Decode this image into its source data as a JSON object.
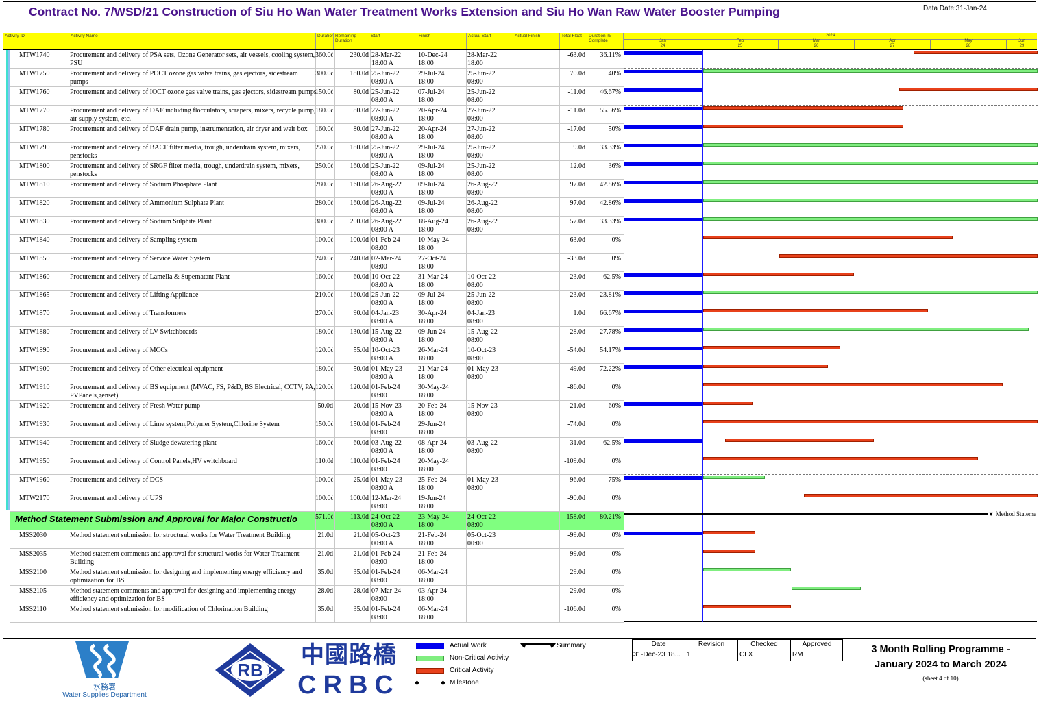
{
  "header": {
    "title": "Contract No. 7/WSD/21 Construction of Siu Ho Wan Water Treatment Works Extension and Siu Ho Wan Raw Water Booster Pumping",
    "data_date": "Data Date:31-Jan-24"
  },
  "columns": [
    "Activity ID",
    "Activity Name",
    "Duration",
    "Remaining Duration",
    "Start",
    "Finish",
    "Actual Start",
    "Actual Finish",
    "Total Float",
    "Duration % Complete"
  ],
  "timescale": {
    "year": "2024",
    "months": [
      {
        "label": "Jan",
        "week": "24"
      },
      {
        "label": "Feb",
        "week": "25"
      },
      {
        "label": "Mar",
        "week": "26"
      },
      {
        "label": "Apr",
        "week": "27"
      },
      {
        "label": "May",
        "week": "28"
      },
      {
        "label": "Jun",
        "week": "29"
      }
    ]
  },
  "rows": [
    {
      "id": "MTW1740",
      "name": "Procurement and delivery of PSA sets, Ozone Generator sets, air vessels, cooling system, PSU",
      "dur": "360.0d",
      "rem": "230.0d",
      "start": "28-Mar-22",
      "start2": "18:00 A",
      "finish": "10-Dec-24",
      "finish2": "18:00",
      "astart": "28-Mar-22",
      "astart2": "18:00",
      "tf": "-63.0d",
      "pc": "36.11%",
      "actual": true,
      "bar": {
        "type": "crit",
        "from": 0.7,
        "to": 1.0
      },
      "dash": true
    },
    {
      "id": "MTW1750",
      "name": "Procurement and delivery of POCT ozone gas valve trains, gas ejectors, sidestream pumps",
      "dur": "300.0d",
      "rem": "180.0d",
      "start": "25-Jun-22",
      "start2": "08:00 A",
      "finish": "29-Jul-24",
      "finish2": "18:00",
      "astart": "25-Jun-22",
      "astart2": "08:00",
      "tf": "70.0d",
      "pc": "40%",
      "actual": true,
      "bar": {
        "type": "ncrit",
        "from": 0.19,
        "to": 1.0
      },
      "dash": false
    },
    {
      "id": "MTW1760",
      "name": "Procurement and delivery of IOCT ozone gas valve trains, gas ejectors, sidestream pumps",
      "dur": "150.0d",
      "rem": "80.0d",
      "start": "25-Jun-22",
      "start2": "08:00 A",
      "finish": "07-Jul-24",
      "finish2": "18:00",
      "astart": "25-Jun-22",
      "astart2": "08:00",
      "tf": "-11.0d",
      "pc": "46.67%",
      "actual": true,
      "bar": {
        "type": "crit",
        "from": 0.665,
        "to": 1.0
      },
      "dash": true
    },
    {
      "id": "MTW1770",
      "name": "Procurement and delivery of DAF including flocculators, scrapers, mixers, recycle pump, air supply system, etc.",
      "dur": "180.0d",
      "rem": "80.0d",
      "start": "27-Jun-22",
      "start2": "08:00 A",
      "finish": "20-Apr-24",
      "finish2": "18:00",
      "astart": "27-Jun-22",
      "astart2": "08:00",
      "tf": "-11.0d",
      "pc": "55.56%",
      "actual": true,
      "bar": {
        "type": "crit",
        "from": 0.19,
        "to": 0.675
      },
      "dash": false
    },
    {
      "id": "MTW1780",
      "name": "Procurement and delivery of DAF drain pump, instrumentation, air dryer and weir box",
      "dur": "160.0d",
      "rem": "80.0d",
      "start": "27-Jun-22",
      "start2": "08:00 A",
      "finish": "20-Apr-24",
      "finish2": "18:00",
      "astart": "27-Jun-22",
      "astart2": "08:00",
      "tf": "-17.0d",
      "pc": "50%",
      "actual": true,
      "bar": {
        "type": "crit",
        "from": 0.19,
        "to": 0.675
      },
      "dash": false
    },
    {
      "id": "MTW1790",
      "name": "Procurement and delivery of BACF filter media, trough, underdrain system, mixers, penstocks",
      "dur": "270.0d",
      "rem": "180.0d",
      "start": "25-Jun-22",
      "start2": "08:00 A",
      "finish": "29-Jul-24",
      "finish2": "18:00",
      "astart": "25-Jun-22",
      "astart2": "08:00",
      "tf": "9.0d",
      "pc": "33.33%",
      "actual": true,
      "bar": {
        "type": "ncrit",
        "from": 0.19,
        "to": 1.0
      },
      "dash": false
    },
    {
      "id": "MTW1800",
      "name": "Procurement and delivery of SRGF filter media, trough, underdrain system, mixers, penstocks",
      "dur": "250.0d",
      "rem": "160.0d",
      "start": "25-Jun-22",
      "start2": "08:00 A",
      "finish": "09-Jul-24",
      "finish2": "18:00",
      "astart": "25-Jun-22",
      "astart2": "08:00",
      "tf": "12.0d",
      "pc": "36%",
      "actual": true,
      "bar": {
        "type": "ncrit",
        "from": 0.19,
        "to": 1.0
      },
      "dash": false
    },
    {
      "id": "MTW1810",
      "name": "Procurement and delivery of Sodium Phosphate Plant",
      "dur": "280.0d",
      "rem": "160.0d",
      "start": "26-Aug-22",
      "start2": "08:00 A",
      "finish": "09-Jul-24",
      "finish2": "18:00",
      "astart": "26-Aug-22",
      "astart2": "08:00",
      "tf": "97.0d",
      "pc": "42.86%",
      "actual": true,
      "bar": {
        "type": "ncrit",
        "from": 0.19,
        "to": 1.0
      },
      "dash": false
    },
    {
      "id": "MTW1820",
      "name": "Procurement and delivery of Ammonium Sulphate Plant",
      "dur": "280.0d",
      "rem": "160.0d",
      "start": "26-Aug-22",
      "start2": "08:00 A",
      "finish": "09-Jul-24",
      "finish2": "18:00",
      "astart": "26-Aug-22",
      "astart2": "08:00",
      "tf": "97.0d",
      "pc": "42.86%",
      "actual": true,
      "bar": {
        "type": "ncrit",
        "from": 0.19,
        "to": 1.0
      },
      "dash": false
    },
    {
      "id": "MTW1830",
      "name": "Procurement and delivery of Sodium Sulphite Plant",
      "dur": "300.0d",
      "rem": "200.0d",
      "start": "26-Aug-22",
      "start2": "08:00 A",
      "finish": "18-Aug-24",
      "finish2": "18:00",
      "astart": "26-Aug-22",
      "astart2": "08:00",
      "tf": "57.0d",
      "pc": "33.33%",
      "actual": true,
      "bar": {
        "type": "ncrit",
        "from": 0.19,
        "to": 1.0
      },
      "dash": false
    },
    {
      "id": "MTW1840",
      "name": "Procurement and delivery of Sampling system",
      "dur": "100.0d",
      "rem": "100.0d",
      "start": "01-Feb-24",
      "start2": "08:00",
      "finish": "10-May-24",
      "finish2": "18:00",
      "astart": "",
      "astart2": "",
      "tf": "-63.0d",
      "pc": "0%",
      "actual": false,
      "bar": {
        "type": "crit",
        "from": 0.19,
        "to": 0.795
      },
      "dash": false
    },
    {
      "id": "MTW1850",
      "name": "Procurement and delivery of Service Water System",
      "dur": "240.0d",
      "rem": "240.0d",
      "start": "02-Mar-24",
      "start2": "08:00",
      "finish": "27-Oct-24",
      "finish2": "18:00",
      "astart": "",
      "astart2": "",
      "tf": "-33.0d",
      "pc": "0%",
      "actual": false,
      "bar": {
        "type": "crit",
        "from": 0.375,
        "to": 1.0
      },
      "dash": false
    },
    {
      "id": "MTW1860",
      "name": "Procurement and delivery of Lamella & Supernatant Plant",
      "dur": "160.0d",
      "rem": "60.0d",
      "start": "10-Oct-22",
      "start2": "08:00 A",
      "finish": "31-Mar-24",
      "finish2": "18:00",
      "astart": "10-Oct-22",
      "astart2": "08:00",
      "tf": "-23.0d",
      "pc": "62.5%",
      "actual": true,
      "bar": {
        "type": "crit",
        "from": 0.19,
        "to": 0.555
      },
      "dash": false
    },
    {
      "id": "MTW1865",
      "name": "Procurement and delivery of Lifting Appliance",
      "dur": "210.0d",
      "rem": "160.0d",
      "start": "25-Jun-22",
      "start2": "08:00 A",
      "finish": "09-Jul-24",
      "finish2": "18:00",
      "astart": "25-Jun-22",
      "astart2": "08:00",
      "tf": "23.0d",
      "pc": "23.81%",
      "actual": true,
      "bar": {
        "type": "ncrit",
        "from": 0.19,
        "to": 1.0
      },
      "dash": false
    },
    {
      "id": "MTW1870",
      "name": "Procurement and delivery of Transformers",
      "dur": "270.0d",
      "rem": "90.0d",
      "start": "04-Jan-23",
      "start2": "08:00 A",
      "finish": "30-Apr-24",
      "finish2": "18:00",
      "astart": "04-Jan-23",
      "astart2": "08:00",
      "tf": "1.0d",
      "pc": "66.67%",
      "actual": true,
      "bar": {
        "type": "crit",
        "from": 0.19,
        "to": 0.735
      },
      "dash": false
    },
    {
      "id": "MTW1880",
      "name": "Procurement and delivery of LV Switchboards",
      "dur": "180.0d",
      "rem": "130.0d",
      "start": "15-Aug-22",
      "start2": "08:00 A",
      "finish": "09-Jun-24",
      "finish2": "18:00",
      "astart": "15-Aug-22",
      "astart2": "08:00",
      "tf": "28.0d",
      "pc": "27.78%",
      "actual": true,
      "bar": {
        "type": "ncrit",
        "from": 0.19,
        "to": 0.978
      },
      "dash": false
    },
    {
      "id": "MTW1890",
      "name": "Procurement and delivery of MCCs",
      "dur": "120.0d",
      "rem": "55.0d",
      "start": "10-Oct-23",
      "start2": "08:00 A",
      "finish": "26-Mar-24",
      "finish2": "18:00",
      "astart": "10-Oct-23",
      "astart2": "08:00",
      "tf": "-54.0d",
      "pc": "54.17%",
      "actual": true,
      "bar": {
        "type": "crit",
        "from": 0.19,
        "to": 0.523
      },
      "dash": false
    },
    {
      "id": "MTW1900",
      "name": "Procurement and delivery of Other electrical equipment",
      "dur": "180.0d",
      "rem": "50.0d",
      "start": "01-May-23",
      "start2": "08:00 A",
      "finish": "21-Mar-24",
      "finish2": "18:00",
      "astart": "01-May-23",
      "astart2": "08:00",
      "tf": "-49.0d",
      "pc": "72.22%",
      "actual": true,
      "bar": {
        "type": "crit",
        "from": 0.19,
        "to": 0.493
      },
      "dash": false
    },
    {
      "id": "MTW1910",
      "name": "Procurement and delivery of BS equipment (MVAC, FS, P&D, BS Electrical, CCTV, PA, PVPanels,genset)",
      "dur": "120.0d",
      "rem": "120.0d",
      "start": "01-Feb-24",
      "start2": "08:00",
      "finish": "30-May-24",
      "finish2": "18:00",
      "astart": "",
      "astart2": "",
      "tf": "-86.0d",
      "pc": "0%",
      "actual": false,
      "bar": {
        "type": "crit",
        "from": 0.19,
        "to": 0.915
      },
      "dash": false
    },
    {
      "id": "MTW1920",
      "name": "Procurement and delivery of Fresh Water pump",
      "dur": "50.0d",
      "rem": "20.0d",
      "start": "15-Nov-23",
      "start2": "08:00 A",
      "finish": "20-Feb-24",
      "finish2": "18:00",
      "astart": "15-Nov-23",
      "astart2": "08:00",
      "tf": "-21.0d",
      "pc": "60%",
      "actual": true,
      "bar": {
        "type": "crit",
        "from": 0.19,
        "to": 0.31
      },
      "dash": false
    },
    {
      "id": "MTW1930",
      "name": "Procurement and delivery of Lime system,Polymer System,Chlorine System",
      "dur": "150.0d",
      "rem": "150.0d",
      "start": "01-Feb-24",
      "start2": "08:00",
      "finish": "29-Jun-24",
      "finish2": "18:00",
      "astart": "",
      "astart2": "",
      "tf": "-74.0d",
      "pc": "0%",
      "actual": false,
      "bar": {
        "type": "crit",
        "from": 0.19,
        "to": 1.0
      },
      "dash": false
    },
    {
      "id": "MTW1940",
      "name": "Procurement and delivery of Sludge dewatering plant",
      "dur": "160.0d",
      "rem": "60.0d",
      "start": "03-Aug-22",
      "start2": "08:00 A",
      "finish": "08-Apr-24",
      "finish2": "18:00",
      "astart": "03-Aug-22",
      "astart2": "08:00",
      "tf": "-31.0d",
      "pc": "62.5%",
      "actual": true,
      "bar": {
        "type": "crit",
        "from": 0.243,
        "to": 0.603
      },
      "dash": true
    },
    {
      "id": "MTW1950",
      "name": "Procurement and delivery of Control Panels,HV switchboard",
      "dur": "110.0d",
      "rem": "110.0d",
      "start": "01-Feb-24",
      "start2": "08:00",
      "finish": "20-May-24",
      "finish2": "18:00",
      "astart": "",
      "astart2": "",
      "tf": "-109.0d",
      "pc": "0%",
      "actual": false,
      "bar": {
        "type": "crit",
        "from": 0.19,
        "to": 0.855
      },
      "dash": true
    },
    {
      "id": "MTW1960",
      "name": "Procurement and delivery of DCS",
      "dur": "100.0d",
      "rem": "25.0d",
      "start": "01-May-23",
      "start2": "08:00 A",
      "finish": "25-Feb-24",
      "finish2": "18:00",
      "astart": "01-May-23",
      "astart2": "08:00",
      "tf": "96.0d",
      "pc": "75%",
      "actual": true,
      "bar": {
        "type": "ncrit",
        "from": 0.19,
        "to": 0.34
      },
      "dash": false
    },
    {
      "id": "MTW2170",
      "name": "Procurement and delivery of UPS",
      "dur": "100.0d",
      "rem": "100.0d",
      "start": "12-Mar-24",
      "start2": "08:00",
      "finish": "19-Jun-24",
      "finish2": "18:00",
      "astart": "",
      "astart2": "",
      "tf": "-90.0d",
      "pc": "0%",
      "actual": false,
      "bar": {
        "type": "crit",
        "from": 0.435,
        "to": 1.0
      },
      "dash": false
    }
  ],
  "summary": {
    "name": "Method Statement Submission and Approval for Major Constructio",
    "dur": "571.0d",
    "rem": "113.0d",
    "start": "24-Oct-22",
    "start2": "08:00 A",
    "finish": "23-May-24",
    "finish2": "18:00",
    "astart": "24-Oct-22",
    "astart2": "08:00",
    "tf": "158.0d",
    "pc": "80.21%",
    "bar_label": "Method Stateme"
  },
  "rows2": [
    {
      "id": "MSS2030",
      "name": "Method statement submission for structural works for Water Treatment Building",
      "dur": "21.0d",
      "rem": "21.0d",
      "start": "05-Oct-23",
      "start2": "00:00 A",
      "finish": "21-Feb-24",
      "finish2": "18:00",
      "astart": "05-Oct-23",
      "astart2": "00:00",
      "tf": "-99.0d",
      "pc": "0%",
      "actual": true,
      "bar": {
        "type": "crit",
        "from": 0.19,
        "to": 0.317
      }
    },
    {
      "id": "MSS2035",
      "name": "Method statement comments and approval for structural works for Water Treatment Building",
      "dur": "21.0d",
      "rem": "21.0d",
      "start": "01-Feb-24",
      "start2": "08:00",
      "finish": "21-Feb-24",
      "finish2": "18:00",
      "astart": "",
      "astart2": "",
      "tf": "-99.0d",
      "pc": "0%",
      "actual": false,
      "bar": {
        "type": "crit",
        "from": 0.19,
        "to": 0.317
      }
    },
    {
      "id": "MSS2100",
      "name": "Method statement submission for designing and implementing energy efficiency and optimization for BS",
      "dur": "35.0d",
      "rem": "35.0d",
      "start": "01-Feb-24",
      "start2": "08:00",
      "finish": "06-Mar-24",
      "finish2": "18:00",
      "astart": "",
      "astart2": "",
      "tf": "29.0d",
      "pc": "0%",
      "actual": false,
      "bar": {
        "type": "ncrit",
        "from": 0.19,
        "to": 0.403
      }
    },
    {
      "id": "MSS2105",
      "name": "Method statement comments and approval for designing and implementing energy efficiency and optimization for BS",
      "dur": "28.0d",
      "rem": "28.0d",
      "start": "07-Mar-24",
      "start2": "08:00",
      "finish": "03-Apr-24",
      "finish2": "18:00",
      "astart": "",
      "astart2": "",
      "tf": "29.0d",
      "pc": "0%",
      "actual": false,
      "bar": {
        "type": "ncrit",
        "from": 0.405,
        "to": 0.572
      }
    },
    {
      "id": "MSS2110",
      "name": "Method statement submission for modification of Chlorination Building",
      "dur": "35.0d",
      "rem": "35.0d",
      "start": "01-Feb-24",
      "start2": "08:00",
      "finish": "06-Mar-24",
      "finish2": "18:00",
      "astart": "",
      "astart2": "",
      "tf": "-106.0d",
      "pc": "0%",
      "actual": false,
      "bar": {
        "type": "crit",
        "from": 0.19,
        "to": 0.403
      }
    }
  ],
  "legend": {
    "actual": "Actual Work",
    "noncritical": "Non-Critical Activity",
    "critical": "Critical Activity",
    "milestone": "Milestone",
    "summary": "Summary"
  },
  "logos": {
    "wsd_chinese": "水務署",
    "wsd_english": "Water Supplies Department",
    "rb": "RB",
    "crbc_chinese": "中國路橋",
    "crbc_english": "CRBC"
  },
  "revision": {
    "headers": [
      "Date",
      "Revision",
      "Checked",
      "Approved"
    ],
    "values": [
      "31-Dec-23 18...",
      "1",
      "CLX",
      "RM"
    ]
  },
  "program": {
    "title1": "3 Month Rolling Programme -",
    "title2": "January 2024 to March 2024",
    "sheet": "(sheet 4 of 10)"
  },
  "colors": {
    "critical": "#e8411b",
    "noncritical": "#80ee80",
    "actual": "#0000ee",
    "summary_row": "#80ff80",
    "header": "#ffff00",
    "title": "#4a148c"
  }
}
